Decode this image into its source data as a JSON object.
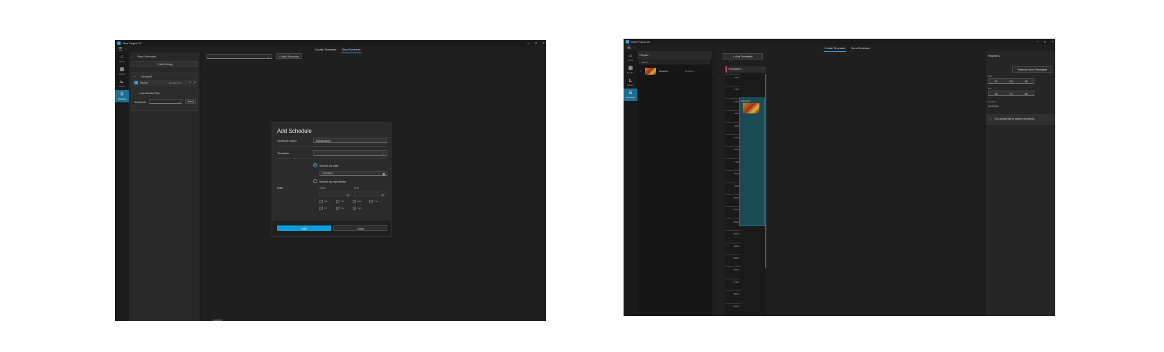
{
  "left": {
    "title": "New Project 22",
    "tabs": [
      "Create Timetable",
      "Send Schedule"
    ],
    "active_tab": 1,
    "rail": [
      {
        "icon": "⌂",
        "label": "Home"
      },
      {
        "icon": "▦",
        "label": "Device"
      },
      {
        "icon": "⊾",
        "label": "Report"
      },
      {
        "icon": "⌸",
        "label": "Schedule"
      }
    ],
    "side": {
      "back_label": "Send Schedule",
      "add_group": "Add Group",
      "group_name": "Group01",
      "device_name": "DS9X0X",
      "device_ip": "192.168.0.55",
      "add_media": "Add Media Play",
      "schedule_label": "Schedule",
      "send_label": "Send"
    },
    "toolbar": {
      "add_schedule": "Add Schedule"
    },
    "dialog": {
      "title": "Add Schedule",
      "schedule_name_label": "Schedule Name",
      "schedule_name_value": "Schedule01",
      "timetable_label": "Timetable",
      "date_label": "Date",
      "specify_date": "Specify by date",
      "date_value": "1/1/2024",
      "specify_repeat": "Specify by repeatedly",
      "start_label": "Start",
      "end_label": "End",
      "days": [
        "Mon",
        "Tue",
        "Wed",
        "Thu",
        "Fri",
        "Sat",
        "Sun"
      ],
      "add_button": "Add",
      "close_button": "Close"
    }
  },
  "right": {
    "title": "New Project 22",
    "tabs": [
      "Create Timetable",
      "Send Schedule"
    ],
    "active_tab": 0,
    "rail": [
      {
        "icon": "⌂",
        "label": "Home"
      },
      {
        "icon": "▦",
        "label": "Device"
      },
      {
        "icon": "⊾",
        "label": "Report"
      },
      {
        "icon": "⌸",
        "label": "Schedule"
      }
    ],
    "playlist_header": "Playlist",
    "search_placeholder": "Search",
    "playlist_item": "Playlist01",
    "playlist_duration": "00:00:20",
    "add_timetable": "Add Timetable",
    "timetable_name": "Timetable01",
    "hours": [
      "0:00",
      "1:00",
      "2:00",
      "3:00",
      "4:00",
      "5:00",
      "6:00",
      "7:00",
      "8:00",
      "9:00",
      "10:00",
      "11:00",
      "12:00",
      "13:00",
      "14:00",
      "15:00",
      "16:00",
      "17:00",
      "18:00",
      "19:00"
    ],
    "block_label": "Playlist01",
    "detail": {
      "title": "Playlist01",
      "remove_button": "Remove from Timetable",
      "start_label": "Start",
      "start": [
        "01",
        "00",
        "00"
      ],
      "end_label": "End",
      "end": [
        "12",
        "07",
        "00"
      ],
      "duration_label": "Duration",
      "duration": "11:00:00",
      "info": "This playlist will be played repeatedly."
    }
  }
}
